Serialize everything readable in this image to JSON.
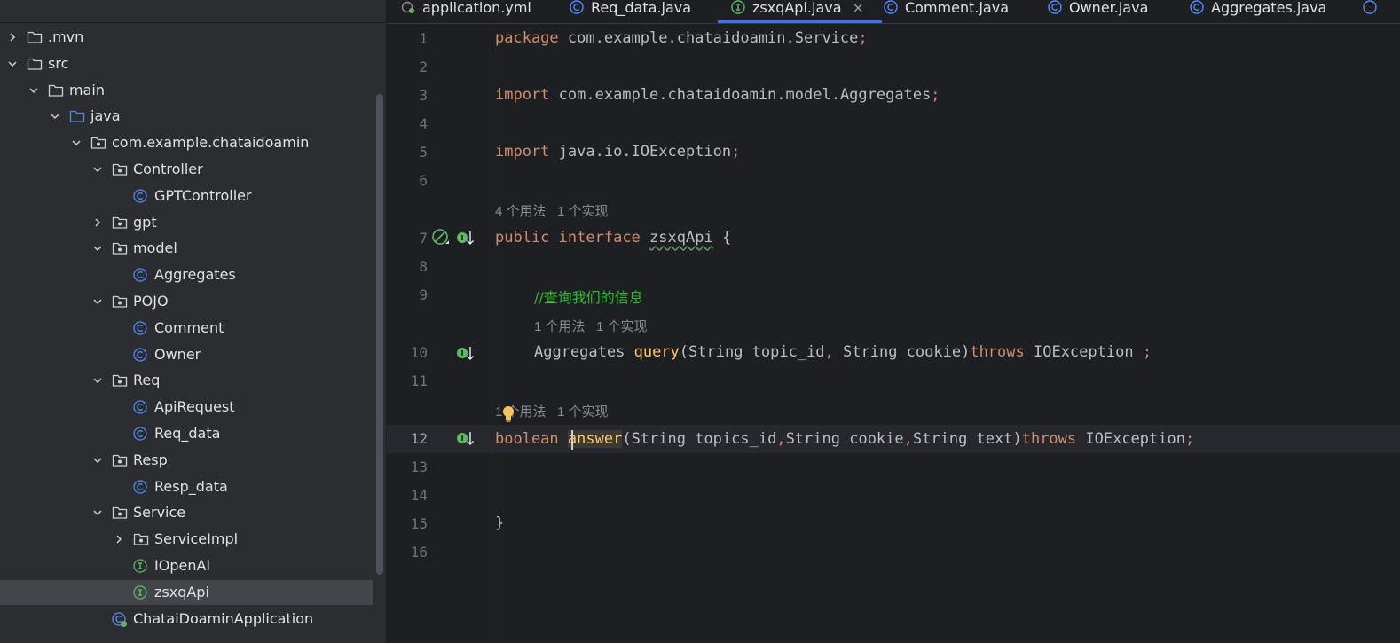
{
  "sidebar": {
    "tree": [
      {
        "label": ".mvn",
        "type": "folder",
        "depth": 0,
        "expanded": false,
        "has_chevron": true
      },
      {
        "label": "src",
        "type": "folder",
        "depth": 0,
        "expanded": true,
        "has_chevron": true
      },
      {
        "label": "main",
        "type": "folder",
        "depth": 1,
        "expanded": true,
        "has_chevron": true
      },
      {
        "label": "java",
        "type": "source-folder",
        "depth": 2,
        "expanded": true,
        "has_chevron": true
      },
      {
        "label": "com.example.chataidoamin",
        "type": "package",
        "depth": 3,
        "expanded": true,
        "has_chevron": true
      },
      {
        "label": "Controller",
        "type": "package",
        "depth": 4,
        "expanded": true,
        "has_chevron": true
      },
      {
        "label": "GPTController",
        "type": "class",
        "depth": 5,
        "has_chevron": false
      },
      {
        "label": "gpt",
        "type": "package",
        "depth": 4,
        "expanded": false,
        "has_chevron": true
      },
      {
        "label": "model",
        "type": "package",
        "depth": 4,
        "expanded": true,
        "has_chevron": true
      },
      {
        "label": "Aggregates",
        "type": "class",
        "depth": 5,
        "has_chevron": false
      },
      {
        "label": "POJO",
        "type": "package",
        "depth": 4,
        "expanded": true,
        "has_chevron": true
      },
      {
        "label": "Comment",
        "type": "class",
        "depth": 5,
        "has_chevron": false
      },
      {
        "label": "Owner",
        "type": "class",
        "depth": 5,
        "has_chevron": false
      },
      {
        "label": "Req",
        "type": "package",
        "depth": 4,
        "expanded": true,
        "has_chevron": true
      },
      {
        "label": "ApiRequest",
        "type": "class",
        "depth": 5,
        "has_chevron": false
      },
      {
        "label": "Req_data",
        "type": "class",
        "depth": 5,
        "has_chevron": false
      },
      {
        "label": "Resp",
        "type": "package",
        "depth": 4,
        "expanded": true,
        "has_chevron": true
      },
      {
        "label": "Resp_data",
        "type": "class",
        "depth": 5,
        "has_chevron": false
      },
      {
        "label": "Service",
        "type": "package",
        "depth": 4,
        "expanded": true,
        "has_chevron": true
      },
      {
        "label": "ServiceImpl",
        "type": "package",
        "depth": 5,
        "expanded": false,
        "has_chevron": true
      },
      {
        "label": "IOpenAI",
        "type": "interface",
        "depth": 5,
        "has_chevron": false
      },
      {
        "label": "zsxqApi",
        "type": "interface",
        "depth": 5,
        "has_chevron": false,
        "selected": true
      },
      {
        "label": "ChataiDoaminApplication",
        "type": "spring-class",
        "depth": 4,
        "has_chevron": false
      }
    ]
  },
  "tabs": [
    {
      "label": "application.yml",
      "icon": "yaml-config-icon",
      "active": false
    },
    {
      "label": "Req_data.java",
      "icon": "class-icon",
      "active": false
    },
    {
      "label": "zsxqApi.java",
      "icon": "interface-icon",
      "active": true,
      "close": "×"
    },
    {
      "label": "Comment.java",
      "icon": "class-icon",
      "active": false
    },
    {
      "label": "Owner.java",
      "icon": "class-icon",
      "active": false
    },
    {
      "label": "Aggregates.java",
      "icon": "class-icon",
      "active": false
    }
  ],
  "editor": {
    "line_numbers": [
      "1",
      "2",
      "3",
      "4",
      "5",
      "6",
      "7",
      "8",
      "9",
      "10",
      "11",
      "12",
      "13",
      "14",
      "15",
      "16"
    ],
    "current_line": "12",
    "code": {
      "l1": {
        "kw": "package",
        "rest": " com.example.chataidoamin.Service",
        "semi": ";"
      },
      "l3": {
        "kw": "import",
        "rest": " com.example.chataidoamin.model.Aggregates",
        "semi": ";"
      },
      "l5": {
        "kw": "import",
        "rest": " java.io.IOException",
        "semi": ";"
      },
      "l7": {
        "kw1": "public",
        "kw2": "interface",
        "name": "zsxqApi",
        "rest": " {"
      },
      "l9": {
        "comment": "//查询我们的信息"
      },
      "l10": {
        "type": "Aggregates ",
        "method": "query",
        "p1": "(String topic_id",
        "c1": ",",
        "p2": " String cookie)",
        "kw": "throws",
        "exc": " IOException ",
        "semi": ";"
      },
      "l12": {
        "kw": "boolean",
        "method": "answer",
        "p1": "(String topics_id",
        "c1": ",",
        "p2": "String cookie",
        "c2": ",",
        "p3": "String text)",
        "kw2": "throws",
        "exc": " IOException",
        "semi": ";"
      },
      "l15": {
        "brace": "}"
      }
    },
    "hints": {
      "h_interface": "4 个用法   1 个实现",
      "h_query": "1 个用法   1 个实现",
      "h_answer": "1 个用法   1 个实现"
    },
    "colors": {
      "keyword": "#cf8e6d",
      "method": "#ffc66d",
      "comment": "#2bbd2b",
      "text": "#bcbec4",
      "accent": "#3574f0"
    }
  }
}
